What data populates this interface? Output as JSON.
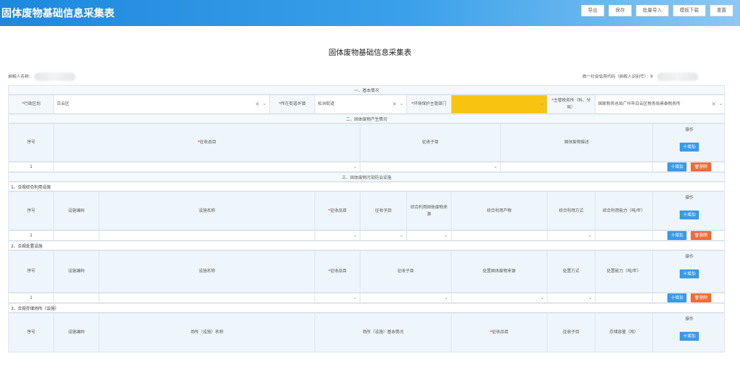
{
  "app": {
    "title": "固体废物基础信息采集表"
  },
  "toolbar": [
    {
      "name": "export-button",
      "label": "导出"
    },
    {
      "name": "save-button",
      "label": "保存"
    },
    {
      "name": "batch-import-button",
      "label": "批量导入"
    },
    {
      "name": "template-download-button",
      "label": "模板下载"
    },
    {
      "name": "reset-button",
      "label": "重置"
    }
  ],
  "form": {
    "title": "固体废物基础信息采集表",
    "taxpayer_name_label": "纳税人名称:",
    "credit_code_label": "统一社会信用代码（纳税人识别号）：",
    "credit_code_prefix": "9"
  },
  "sections": {
    "basic": "一、基本情况",
    "produce": "二、固体废物产生情况",
    "facility": "三、固体废物污染防治设施",
    "sub1": "1、合规综合利用设施",
    "sub2": "2、合规处置设施",
    "sub3": "3、合规存储场所（设施）"
  },
  "basic": {
    "district_label": "行政区划",
    "district_value": "白云区",
    "town_label": "所在街道乡镇",
    "town_value": "松洲街道",
    "env_label": "环境保护主管部门",
    "tax_label": "主管税务所（科、分局）",
    "tax_value": "国家税务总局广州市白云区税务局景泰税务所"
  },
  "common": {
    "seq": "序号",
    "item": "征收品目",
    "subitem": "征收子目",
    "op": "操作",
    "add": "十增加",
    "del": "删除",
    "facility_code": "设施编码",
    "facility_name": "设施名称",
    "row1": "1"
  },
  "produce": {
    "desc": "固体废物描述"
  },
  "t1": {
    "source": "综合利用固体废物来源",
    "product": "综合利用产物",
    "method": "综合利用方式",
    "capacity": "综合利用能力（吨/年）"
  },
  "t2": {
    "source": "处置固体废物来源",
    "method": "处置方式",
    "capacity": "处置能力（吨/年）"
  },
  "t3": {
    "name": "场所（设施）名称",
    "basic": "场所（设施）基本情况",
    "capacity": "存储容量（吨）"
  },
  "icons": {
    "chevron": "chevron-down-icon",
    "clear": "clear-icon",
    "trash": "trash-icon"
  },
  "colors": {
    "header": "#2a8fe0",
    "required": "#e0293a",
    "add": "#3a9ae8",
    "del": "#f06b3a",
    "highlight": "#f7c412"
  }
}
